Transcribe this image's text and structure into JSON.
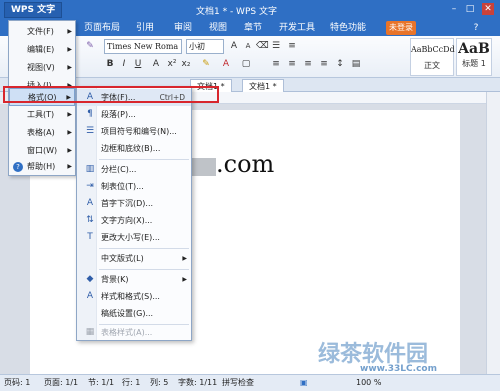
{
  "titlebar": {
    "app_button": "WPS 文字",
    "doc_title": "文档1 * - WPS 文字"
  },
  "ribbon_tabs": [
    "页面布局",
    "引用",
    "审阅",
    "视图",
    "章节",
    "开发工具",
    "特色功能"
  ],
  "login_button": "未登录",
  "toolbar": {
    "font_name": "Times New Roma",
    "font_size": "小初",
    "styles": [
      {
        "sample": "AaBbCcDd",
        "name": "正文"
      },
      {
        "sample": "AaB",
        "name": "标题 1"
      }
    ]
  },
  "doc_tabs": [
    "文档1 *",
    "文档1 *"
  ],
  "page_text": ".com",
  "app_menu": {
    "items": [
      {
        "label": "文件(F)"
      },
      {
        "label": "编辑(E)"
      },
      {
        "label": "视图(V)"
      },
      {
        "label": "插入(I)"
      },
      {
        "label": "格式(O)"
      },
      {
        "label": "工具(T)"
      },
      {
        "label": "表格(A)"
      },
      {
        "label": "窗口(W)"
      },
      {
        "label": "帮助(H)"
      }
    ]
  },
  "format_menu": {
    "items": [
      {
        "icon": "A",
        "label": "字体(F)...",
        "shortcut": "Ctrl+D"
      },
      {
        "icon": "¶",
        "label": "段落(P)..."
      },
      {
        "icon": "☰",
        "label": "项目符号和编号(N)..."
      },
      {
        "icon": "",
        "label": "边框和底纹(B)..."
      },
      {
        "icon": "▥",
        "label": "分栏(C)..."
      },
      {
        "icon": "⇥",
        "label": "制表位(T)..."
      },
      {
        "icon": "A",
        "label": "首字下沉(D)..."
      },
      {
        "icon": "⇅",
        "label": "文字方向(X)..."
      },
      {
        "icon": "T",
        "label": "更改大小写(E)..."
      },
      {
        "icon": "",
        "label": "中文版式(L)"
      },
      {
        "icon": "◆",
        "label": "背景(K)"
      },
      {
        "icon": "A",
        "label": "样式和格式(S)..."
      },
      {
        "icon": "",
        "label": "稿纸设置(G)..."
      },
      {
        "icon": "▦",
        "label": "表格样式(A)..."
      }
    ]
  },
  "statusbar": {
    "page": "页码: 1",
    "pages": "页面: 1/1",
    "section": "节: 1/1",
    "row": "行: 1",
    "col": "列: 5",
    "words": "字数: 1/11",
    "spellcheck": "拼写检查",
    "zoom": "100 %"
  },
  "watermark": {
    "text": "绿茶软件园",
    "url": "www.33LC.com"
  }
}
